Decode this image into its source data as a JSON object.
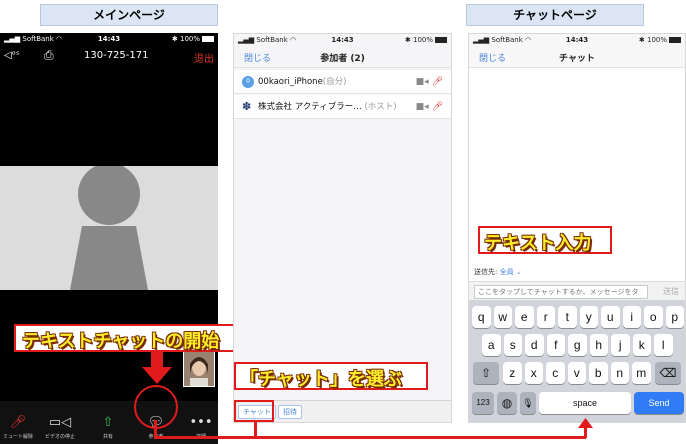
{
  "labels": {
    "main_page": "メインページ",
    "chat_page": "チャットページ"
  },
  "status_bar": {
    "carrier": "SoftBank",
    "time": "14:43",
    "battery": "100%"
  },
  "phone1": {
    "audio": "◁ᵒˢ",
    "meeting_id": "130-725-171",
    "leave": "退出",
    "toolbar": [
      {
        "label": "ミュート解除",
        "icon": "mic-muted-icon"
      },
      {
        "label": "ビデオの停止",
        "icon": "video-icon"
      },
      {
        "label": "共有",
        "icon": "share-icon"
      },
      {
        "label": "参加者",
        "icon": "participants-icon"
      },
      {
        "label": "詳細",
        "icon": "more-icon"
      }
    ]
  },
  "phone2": {
    "close": "閉じる",
    "title": "参加者 (2)",
    "participants": [
      {
        "avatar": "0",
        "name": "00kaori_iPhone",
        "tag": "(自分)"
      },
      {
        "avatar": "",
        "name": "株式会社 アクティブラー…",
        "tag": "(ホスト)"
      }
    ],
    "footer": {
      "chat": "チャット",
      "invite": "招待"
    }
  },
  "phone3": {
    "close": "閉じる",
    "title": "チャット",
    "send_to_label": "送信先:",
    "send_to_value": "全員",
    "input_placeholder": "ここをタップしてチャットするか、メッセージをタ",
    "send": "送信",
    "keyboard": {
      "row1": [
        "q",
        "w",
        "e",
        "r",
        "t",
        "y",
        "u",
        "i",
        "o",
        "p"
      ],
      "row2": [
        "a",
        "s",
        "d",
        "f",
        "g",
        "h",
        "j",
        "k",
        "l"
      ],
      "row3": [
        "z",
        "x",
        "c",
        "v",
        "b",
        "n",
        "m"
      ],
      "num": "123",
      "space": "space",
      "send": "Send"
    }
  },
  "annotations": {
    "start_text_chat": "テキストチャットの開始",
    "choose_chat": "「チャット」を選ぶ",
    "text_input": "テキスト入力"
  },
  "colors": {
    "accent_red": "#e11b1b",
    "annotation_yellow": "#ffef2a",
    "ios_blue": "#2f7cf6"
  }
}
